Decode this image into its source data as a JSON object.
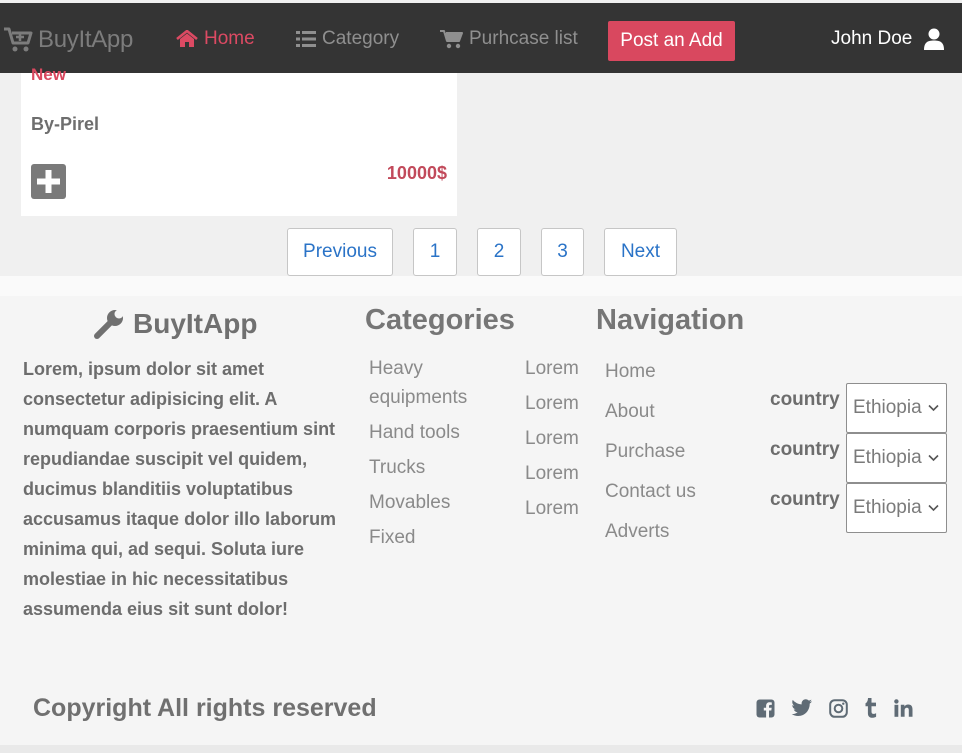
{
  "navbar": {
    "brand": "BuyItApp",
    "links": [
      {
        "label": "Home",
        "icon": "home-icon",
        "active": true
      },
      {
        "label": "Category",
        "icon": "list-icon",
        "active": false
      },
      {
        "label": "Purhcase list",
        "icon": "cart-icon",
        "active": false
      }
    ],
    "post_button": "Post an Add",
    "user_name": "John Doe"
  },
  "card": {
    "condition": "New",
    "seller": "By-Pirel",
    "price": "10000$"
  },
  "pagination": {
    "previous": "Previous",
    "pages": [
      "1",
      "2",
      "3"
    ],
    "next": "Next"
  },
  "footer": {
    "brand": "BuyItApp",
    "about": "Lorem, ipsum dolor sit amet consectetur adipisicing elit. A numquam corporis praesentium sint repudiandae suscipit vel quidem, ducimus blanditiis voluptatibus accusamus itaque dolor illo laborum minima qui, ad sequi. Soluta iure molestiae in hic necessitatibus assumenda eius sit sunt dolor!",
    "categories_title": "Categories",
    "categories": [
      "Heavy equipments",
      "Hand tools",
      "Trucks",
      "Movables",
      "Fixed"
    ],
    "lorem_links": [
      "Lorem",
      "Lorem",
      "Lorem",
      "Lorem",
      "Lorem"
    ],
    "navigation_title": "Navigation",
    "navigation": [
      "Home",
      "About",
      "Purchase",
      "Contact us",
      "Adverts"
    ],
    "country_selectors": [
      {
        "label": "country",
        "value": "Ethiopia"
      },
      {
        "label": "country",
        "value": "Ethiopia"
      },
      {
        "label": "country",
        "value": "Ethiopia"
      }
    ],
    "copyright": "Copyright All rights reserved",
    "socials": [
      "facebook-icon",
      "twitter-icon",
      "instagram-icon",
      "tumblr-icon",
      "linkedin-icon"
    ]
  },
  "colors": {
    "navbar_bg": "#343434",
    "accent": "#d9485f",
    "link_blue": "#2a73c7"
  }
}
